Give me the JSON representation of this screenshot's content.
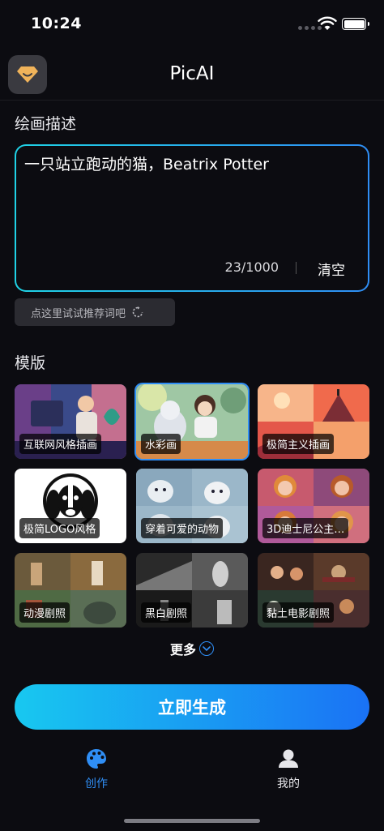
{
  "status_bar": {
    "time": "10:24"
  },
  "nav": {
    "title": "PicAI"
  },
  "prompt": {
    "section_label": "绘画描述",
    "text": "一只站立跑动的猫，Beatrix Potter",
    "char_count": "23/1000",
    "clear_label": "清空"
  },
  "suggest": {
    "label": "点这里试试推荐词吧"
  },
  "templates": {
    "section_label": "模版",
    "items": [
      {
        "label": "互联网风格插画"
      },
      {
        "label": "水彩画"
      },
      {
        "label": "极简主义插画"
      },
      {
        "label": "极简LOGO风格"
      },
      {
        "label": "穿着可爱的动物"
      },
      {
        "label": "3D迪士尼公主…"
      },
      {
        "label": "动漫剧照"
      },
      {
        "label": "黑白剧照"
      },
      {
        "label": "黏土电影剧照"
      }
    ],
    "selected_index": 1
  },
  "more": {
    "label": "更多"
  },
  "generate": {
    "label": "立即生成"
  },
  "tabbar": {
    "items": [
      {
        "label": "创作",
        "icon": "palette-icon",
        "active": true
      },
      {
        "label": "我的",
        "icon": "person-icon",
        "active": false
      }
    ]
  },
  "colors": {
    "accent": "#2f8ef5",
    "gradient_start": "#18c8f0",
    "gradient_end": "#1a72f5",
    "background": "#0c0c11"
  }
}
